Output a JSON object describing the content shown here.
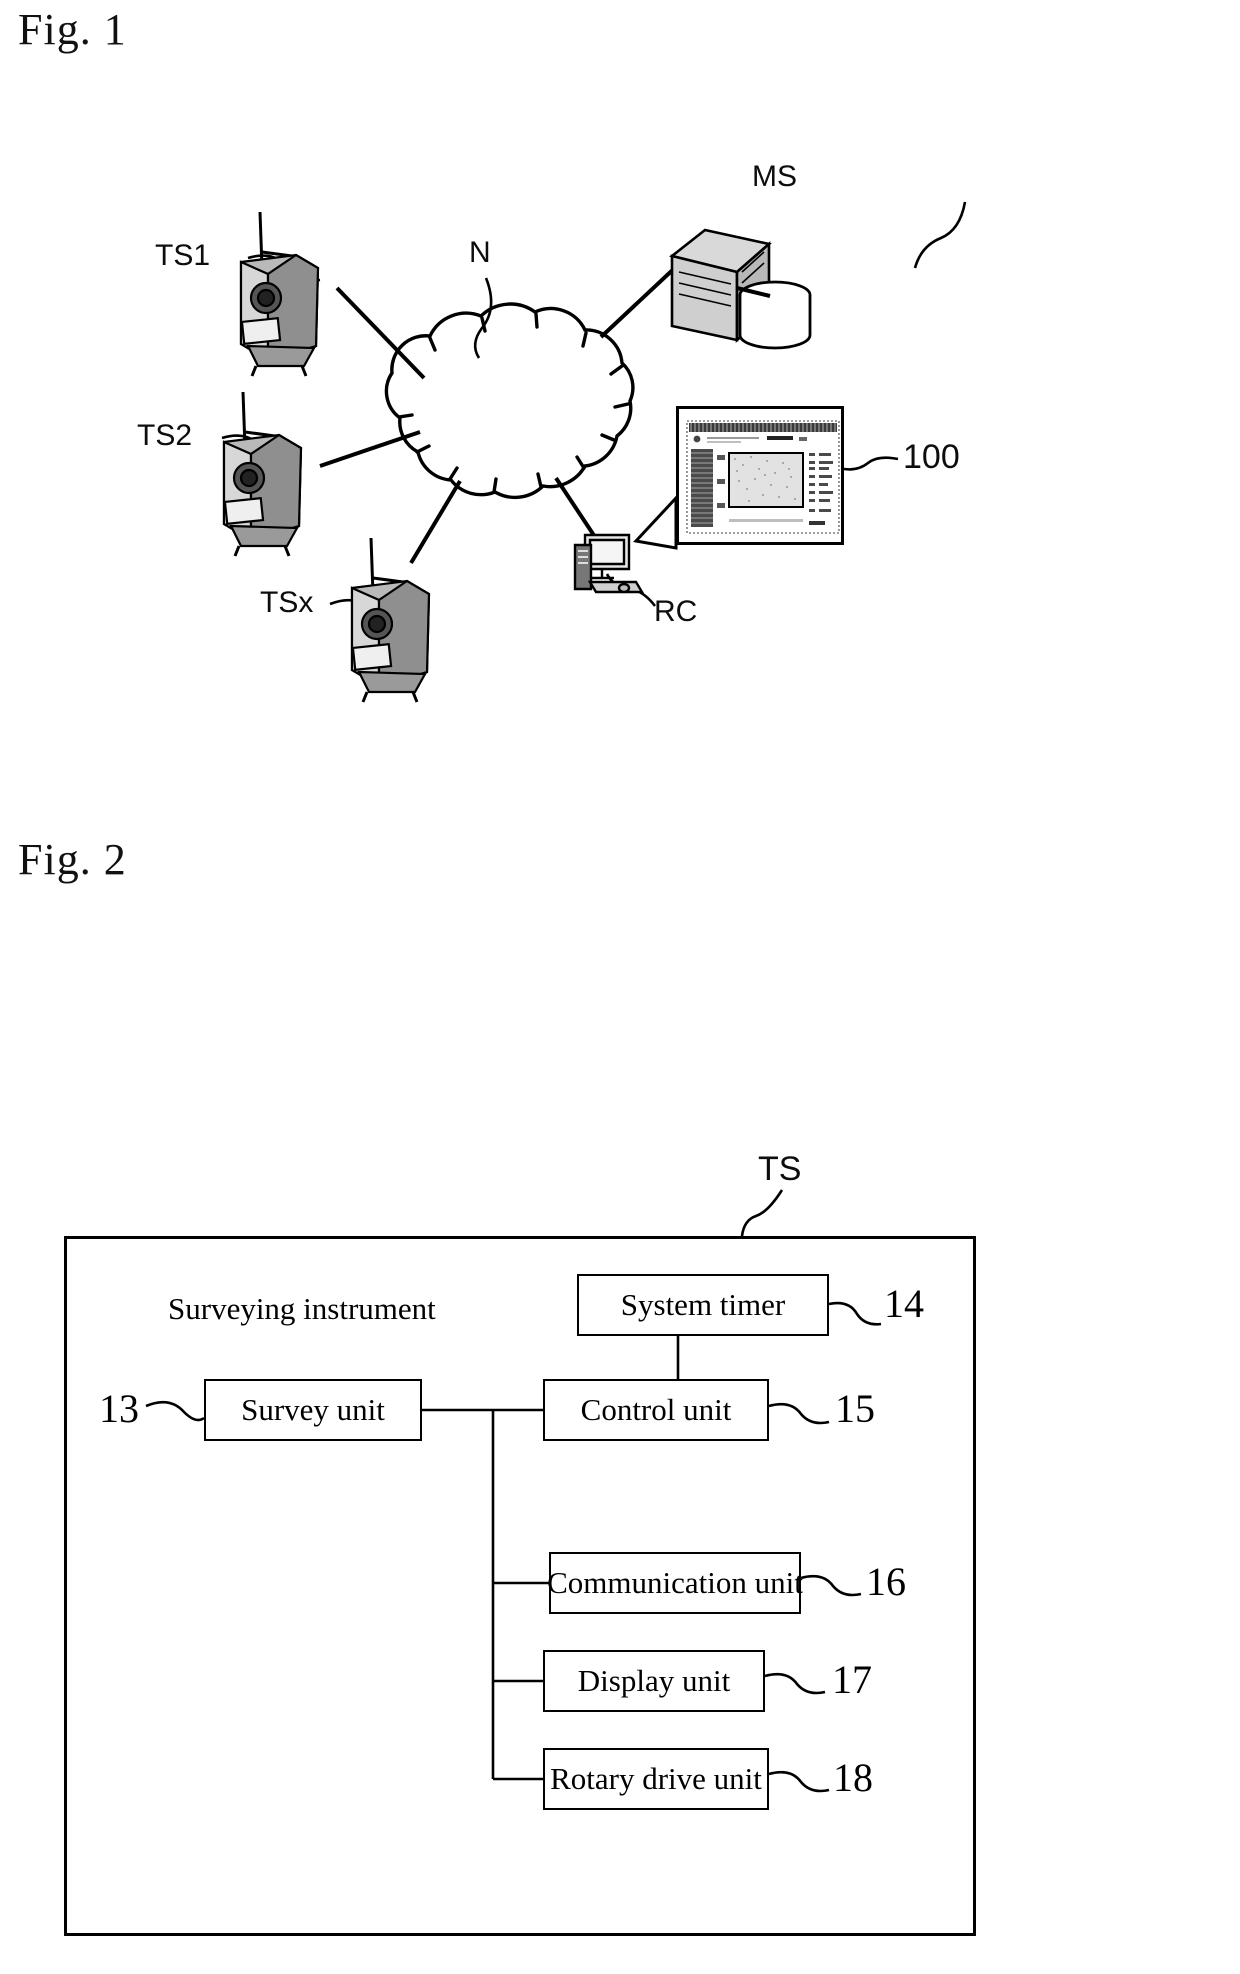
{
  "figures": [
    {
      "caption": "Fig. 1",
      "type": "network-topology",
      "labels": {
        "ts1": "TS1",
        "ts2": "TS2",
        "tsx": "TSx",
        "network": "N",
        "server": "MS",
        "remote_computer": "RC",
        "screen_callout": "100"
      },
      "nodes": [
        {
          "id": "ts1",
          "label": "TS1",
          "kind": "total-station"
        },
        {
          "id": "ts2",
          "label": "TS2",
          "kind": "total-station"
        },
        {
          "id": "tsx",
          "label": "TSx",
          "kind": "total-station"
        },
        {
          "id": "n",
          "label": "N",
          "kind": "cloud-network"
        },
        {
          "id": "ms",
          "label": "MS",
          "kind": "server-and-database"
        },
        {
          "id": "rc",
          "label": "RC",
          "kind": "desktop-computer"
        },
        {
          "id": "100",
          "label": "100",
          "kind": "screen-inset"
        }
      ],
      "links": [
        {
          "from": "ts1",
          "to": "n"
        },
        {
          "from": "ts2",
          "to": "n"
        },
        {
          "from": "tsx",
          "to": "n"
        },
        {
          "from": "n",
          "to": "ms"
        },
        {
          "from": "n",
          "to": "rc"
        },
        {
          "from": "rc",
          "to": "100"
        }
      ]
    },
    {
      "caption": "Fig. 2",
      "type": "block-diagram",
      "outer_label": "TS",
      "inner_title": "Surveying instrument",
      "blocks": [
        {
          "ref": "13",
          "label": "Survey unit"
        },
        {
          "ref": "14",
          "label": "System timer"
        },
        {
          "ref": "15",
          "label": "Control unit"
        },
        {
          "ref": "16",
          "label": "Communication unit"
        },
        {
          "ref": "17",
          "label": "Display unit"
        },
        {
          "ref": "18",
          "label": "Rotary drive unit"
        }
      ]
    }
  ],
  "colors": {
    "ink": "#000000",
    "paper": "#ffffff"
  }
}
